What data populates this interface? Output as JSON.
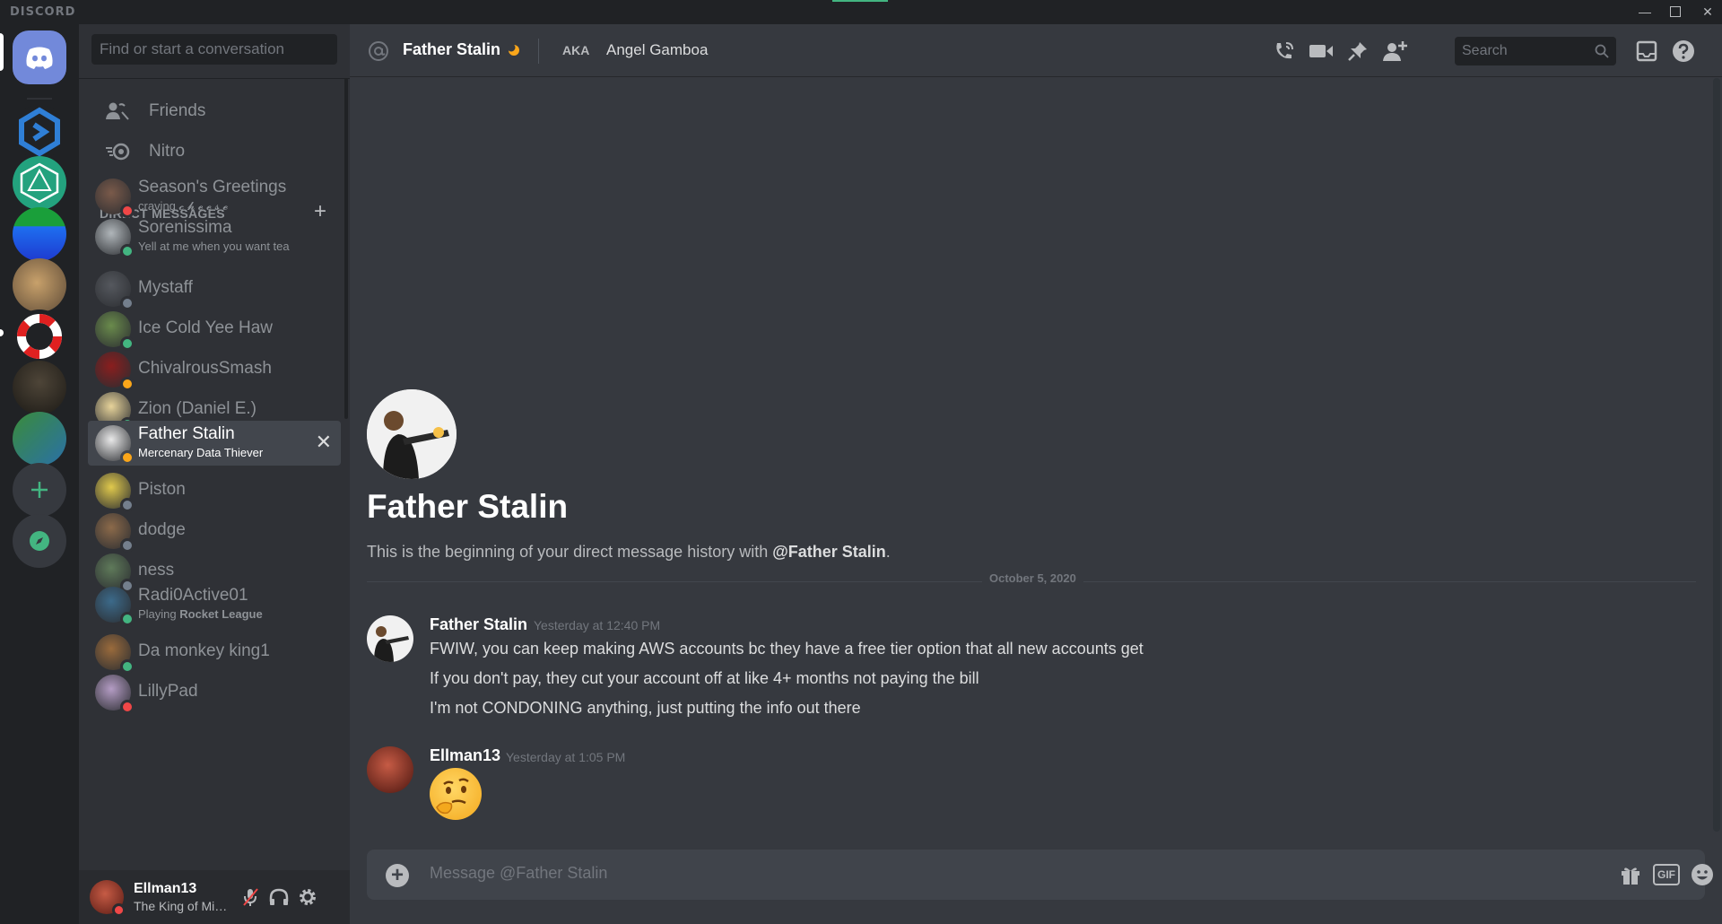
{
  "window": {
    "brand": "DISCORD",
    "minimize": "—",
    "close": "✕"
  },
  "sidebar": {
    "search_placeholder": "Find or start a conversation",
    "nav": [
      {
        "label": "Friends",
        "icon": "friends-icon"
      },
      {
        "label": "Nitro",
        "icon": "nitro-icon"
      }
    ],
    "dm_header": "DIRECT MESSAGES",
    "dm_add": "+",
    "dms": [
      {
        "name": "Season's Greetings",
        "sub": "craving 𝓬 𝓱 𝓮 𝓮 𝓼 𝓮",
        "status": "dnd"
      },
      {
        "name": "Sorenissima",
        "sub": "Yell at me when you want tea",
        "status": "online"
      },
      {
        "name": "Mystaff",
        "sub": "",
        "status": "offline"
      },
      {
        "name": "Ice Cold Yee Haw",
        "sub": "",
        "status": "online"
      },
      {
        "name": "ChivalrousSmash",
        "sub": "",
        "status": "idle"
      },
      {
        "name": "Zion (Daniel E.)",
        "sub": "",
        "status": "online"
      },
      {
        "name": "Father Stalin",
        "sub": "Mercenary Data Thiever",
        "status": "idle",
        "active": true,
        "close": "✕"
      },
      {
        "name": "Piston",
        "sub": "",
        "status": "offline"
      },
      {
        "name": "dodge",
        "sub": "",
        "status": "offline"
      },
      {
        "name": "ness",
        "sub": "",
        "status": "offline"
      },
      {
        "name": "Radi0Active01",
        "sub_prefix": "Playing ",
        "sub_game": "Rocket League",
        "status": "online"
      },
      {
        "name": "Da monkey king1",
        "sub": "",
        "status": "online"
      },
      {
        "name": "LillyPad",
        "sub": "",
        "status": "dnd"
      }
    ]
  },
  "user": {
    "name": "Ellman13",
    "tag": "The King of Mischief",
    "status": "dnd"
  },
  "header": {
    "name": "Father Stalin",
    "aka_label": "AKA",
    "nickname": "Angel Gamboa",
    "search_placeholder": "Search",
    "icons": [
      "voice-call-icon",
      "video-call-icon",
      "pin-icon",
      "add-friend-icon",
      "inbox-icon",
      "help-icon"
    ]
  },
  "chat": {
    "intro_title": "Father Stalin",
    "intro_prefix": "This is the beginning of your direct message history with ",
    "intro_mention": "@Father Stalin",
    "intro_suffix": ".",
    "date_divider": "October 5, 2020",
    "messages": [
      {
        "author": "Father Stalin",
        "time": "Yesterday at 12:40 PM",
        "lines": [
          "FWIW, you can keep making AWS accounts bc they have a free tier option that all new accounts get",
          "If you don't pay, they cut your account off at like 4+ months not paying the bill",
          "I'm not CONDONING anything, just putting the info out there"
        ]
      },
      {
        "author": "Ellman13",
        "time": "Yesterday at 1:05 PM",
        "emoji": "thinking-face"
      }
    ]
  },
  "composer": {
    "placeholder": "Message @Father Stalin",
    "gif_label": "GIF"
  },
  "colors": {
    "blurple": "#7289da",
    "online": "#43b581",
    "idle": "#faa61a",
    "dnd": "#f04747",
    "offline": "#747f8d"
  }
}
